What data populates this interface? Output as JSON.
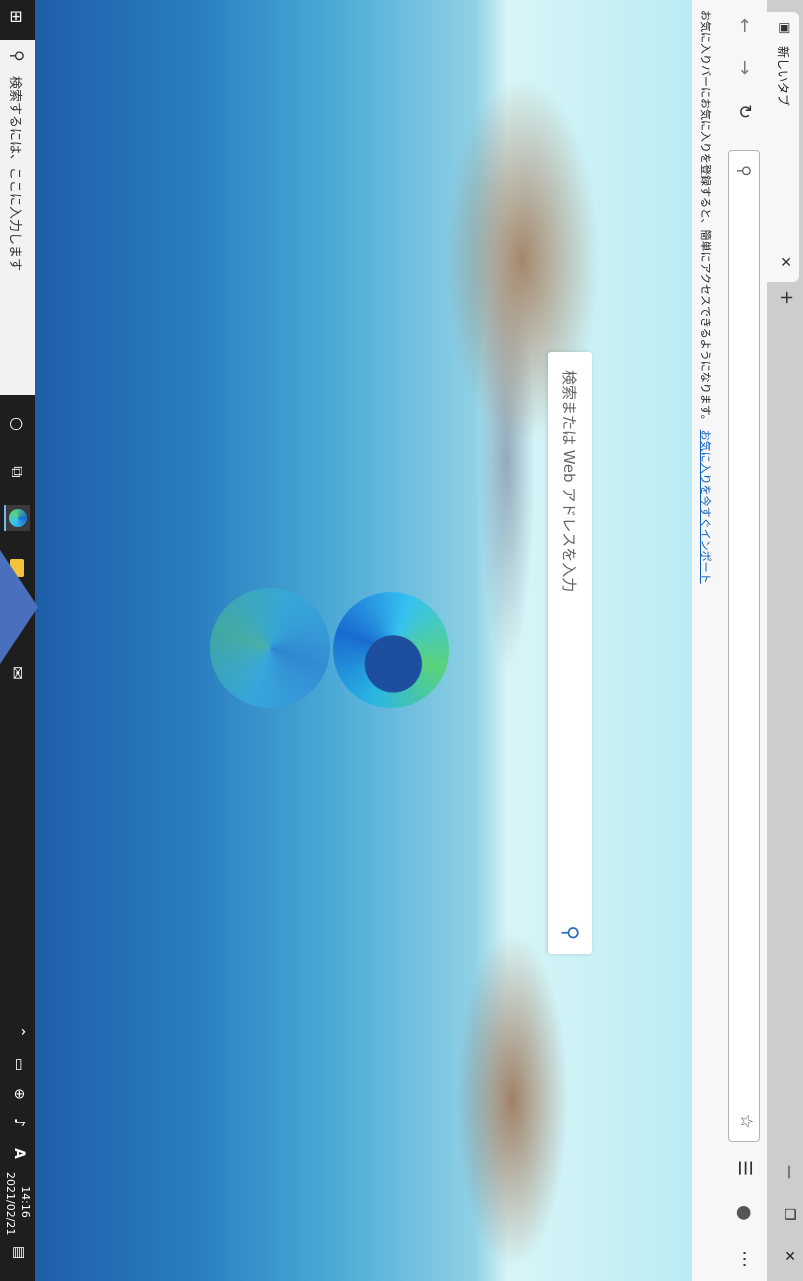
{
  "tab": {
    "title": "新しいタブ"
  },
  "window_controls": {
    "minimize": "—",
    "maximize": "❐",
    "close": "✕"
  },
  "toolbar": {
    "address_placeholder": ""
  },
  "favorites_bar": {
    "message": "お気に入りバーにお気に入りを登録すると、簡単にアクセスできるようになります。",
    "link": "お気に入りを今すぐインポート"
  },
  "newtab": {
    "search_placeholder": "検索または Web アドレスを入力"
  },
  "taskbar": {
    "search_placeholder": "検索するには、ここに入力します",
    "ime_indicator": "A",
    "time": "14:16",
    "date": "2021/02/21"
  },
  "icons": {
    "tab": "tab-icon",
    "close": "close-icon",
    "new_tab": "plus-icon",
    "back": "back-arrow-icon",
    "forward": "forward-arrow-icon",
    "refresh": "refresh-icon",
    "search": "search-icon",
    "favorite": "star-icon",
    "favorites": "favorites-icon",
    "profile": "profile-icon",
    "more": "more-icon"
  },
  "colors": {
    "accent": "#4a6fbd",
    "link": "#0a5db8",
    "taskbar": "#1e1e1e"
  }
}
